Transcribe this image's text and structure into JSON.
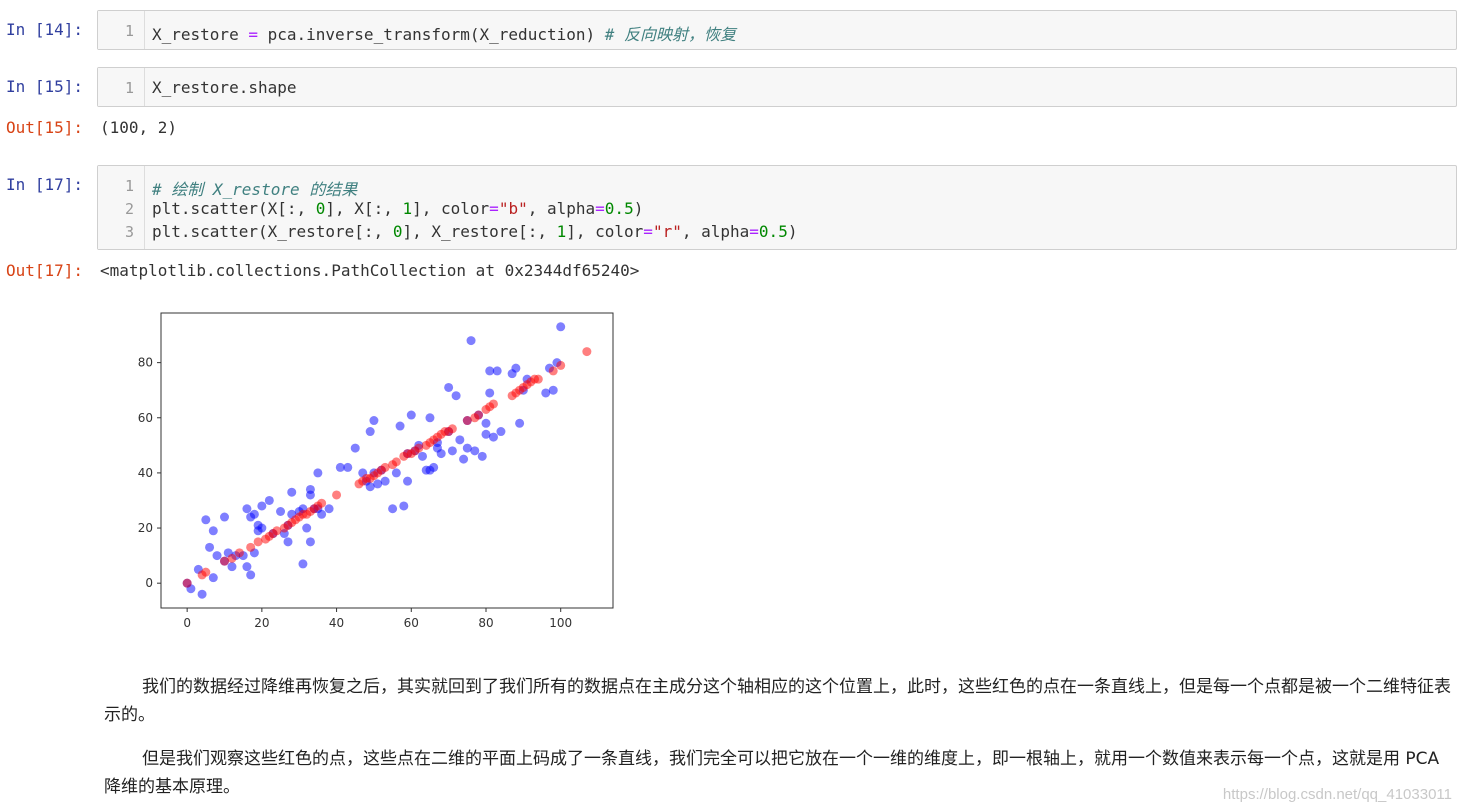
{
  "cells": [
    {
      "prompt": "In  [14]:",
      "lines": [
        {
          "n": "1",
          "parts": [
            {
              "t": "X_restore ",
              "c": ""
            },
            {
              "t": "=",
              "c": "op"
            },
            {
              "t": " pca.inverse_transform(X_reduction) ",
              "c": ""
            },
            {
              "t": "# 反向映射，恢复",
              "c": "cm"
            }
          ]
        }
      ]
    },
    {
      "prompt": "In  [15]:",
      "lines": [
        {
          "n": "1",
          "parts": [
            {
              "t": "X_restore.shape",
              "c": ""
            }
          ]
        }
      ],
      "out_prompt": "Out[15]:",
      "out": "(100, 2)"
    },
    {
      "prompt": "In  [17]:",
      "lines": [
        {
          "n": "1",
          "parts": [
            {
              "t": "# 绘制 X_restore 的结果",
              "c": "cm"
            }
          ]
        },
        {
          "n": "2",
          "parts": [
            {
              "t": "plt.scatter(X[:, ",
              "c": ""
            },
            {
              "t": "0",
              "c": "num"
            },
            {
              "t": "], X[:, ",
              "c": ""
            },
            {
              "t": "1",
              "c": "num"
            },
            {
              "t": "], color",
              "c": ""
            },
            {
              "t": "=",
              "c": "op"
            },
            {
              "t": "\"b\"",
              "c": "str"
            },
            {
              "t": ", alpha",
              "c": ""
            },
            {
              "t": "=",
              "c": "op"
            },
            {
              "t": "0.5",
              "c": "num"
            },
            {
              "t": ")",
              "c": ""
            }
          ]
        },
        {
          "n": "3",
          "parts": [
            {
              "t": "plt.scatter(X_restore[:, ",
              "c": ""
            },
            {
              "t": "0",
              "c": "num"
            },
            {
              "t": "], X_restore[:, ",
              "c": ""
            },
            {
              "t": "1",
              "c": "num"
            },
            {
              "t": "], color",
              "c": ""
            },
            {
              "t": "=",
              "c": "op"
            },
            {
              "t": "\"r\"",
              "c": "str"
            },
            {
              "t": ", alpha",
              "c": ""
            },
            {
              "t": "=",
              "c": "op"
            },
            {
              "t": "0.5",
              "c": "num"
            },
            {
              "t": ")",
              "c": ""
            }
          ]
        }
      ],
      "out_prompt": "Out[17]:",
      "out": "<matplotlib.collections.PathCollection at 0x2344df65240>"
    }
  ],
  "paragraphs": [
    "我们的数据经过降维再恢复之后，其实就回到了我们所有的数据点在主成分这个轴相应的这个位置上，此时，这些红色的点在一条直线上，但是每一个点都是被一个二维特征表示的。",
    "但是我们观察这些红色的点，这些点在二维的平面上码成了一条直线，我们完全可以把它放在一个一维的维度上，即一根轴上，就用一个数值来表示每一个点，这就是用 PCA 降维的基本原理。"
  ],
  "watermark": "https://blog.csdn.net/qq_41033011",
  "chart_data": {
    "type": "scatter",
    "xlim": [
      -7,
      114
    ],
    "ylim": [
      -9,
      98
    ],
    "xticks": [
      "0",
      "20",
      "40",
      "60",
      "80",
      "100"
    ],
    "yticks": [
      "0",
      "20",
      "40",
      "60",
      "80"
    ],
    "grid": false,
    "series": [
      {
        "color": "#0000ff",
        "alpha": 0.5,
        "points": [
          [
            0,
            0
          ],
          [
            1,
            -2
          ],
          [
            3,
            5
          ],
          [
            4,
            -4
          ],
          [
            5,
            23
          ],
          [
            6,
            13
          ],
          [
            7,
            2
          ],
          [
            7,
            19
          ],
          [
            8,
            10
          ],
          [
            10,
            8
          ],
          [
            10,
            24
          ],
          [
            11,
            11
          ],
          [
            12,
            6
          ],
          [
            13,
            10
          ],
          [
            15,
            10
          ],
          [
            16,
            6
          ],
          [
            16,
            27
          ],
          [
            17,
            3
          ],
          [
            17,
            24
          ],
          [
            18,
            25
          ],
          [
            18,
            11
          ],
          [
            19,
            21
          ],
          [
            19,
            19
          ],
          [
            20,
            20
          ],
          [
            20,
            28
          ],
          [
            22,
            30
          ],
          [
            23,
            18
          ],
          [
            25,
            26
          ],
          [
            26,
            18
          ],
          [
            27,
            15
          ],
          [
            27,
            21
          ],
          [
            28,
            25
          ],
          [
            28,
            33
          ],
          [
            30,
            26
          ],
          [
            31,
            27
          ],
          [
            31,
            7
          ],
          [
            32,
            20
          ],
          [
            33,
            32
          ],
          [
            33,
            34
          ],
          [
            33,
            15
          ],
          [
            34,
            27
          ],
          [
            35,
            27
          ],
          [
            35,
            40
          ],
          [
            36,
            25
          ],
          [
            38,
            27
          ],
          [
            41,
            42
          ],
          [
            43,
            42
          ],
          [
            45,
            49
          ],
          [
            47,
            40
          ],
          [
            48,
            37
          ],
          [
            49,
            35
          ],
          [
            49,
            55
          ],
          [
            50,
            40
          ],
          [
            50,
            59
          ],
          [
            51,
            36
          ],
          [
            52,
            41
          ],
          [
            53,
            37
          ],
          [
            55,
            27
          ],
          [
            56,
            40
          ],
          [
            57,
            57
          ],
          [
            58,
            28
          ],
          [
            59,
            47
          ],
          [
            59,
            37
          ],
          [
            60,
            61
          ],
          [
            61,
            48
          ],
          [
            62,
            50
          ],
          [
            63,
            46
          ],
          [
            64,
            41
          ],
          [
            65,
            41
          ],
          [
            65,
            60
          ],
          [
            66,
            42
          ],
          [
            67,
            51
          ],
          [
            67,
            49
          ],
          [
            68,
            47
          ],
          [
            70,
            71
          ],
          [
            70,
            55
          ],
          [
            71,
            48
          ],
          [
            72,
            68
          ],
          [
            73,
            52
          ],
          [
            74,
            45
          ],
          [
            75,
            49
          ],
          [
            75,
            59
          ],
          [
            76,
            88
          ],
          [
            77,
            48
          ],
          [
            78,
            61
          ],
          [
            79,
            46
          ],
          [
            80,
            54
          ],
          [
            80,
            58
          ],
          [
            81,
            69
          ],
          [
            81,
            77
          ],
          [
            82,
            53
          ],
          [
            83,
            77
          ],
          [
            84,
            55
          ],
          [
            87,
            76
          ],
          [
            88,
            78
          ],
          [
            89,
            58
          ],
          [
            90,
            70
          ],
          [
            91,
            74
          ],
          [
            96,
            69
          ],
          [
            97,
            78
          ],
          [
            98,
            70
          ],
          [
            99,
            80
          ],
          [
            100,
            93
          ]
        ]
      },
      {
        "color": "#ff0000",
        "alpha": 0.5,
        "points": [
          [
            0,
            0
          ],
          [
            4,
            3
          ],
          [
            5,
            4
          ],
          [
            10,
            8
          ],
          [
            12,
            9
          ],
          [
            14,
            11
          ],
          [
            17,
            13
          ],
          [
            19,
            15
          ],
          [
            21,
            16
          ],
          [
            22,
            17
          ],
          [
            23,
            18
          ],
          [
            24,
            19
          ],
          [
            26,
            20
          ],
          [
            27,
            21
          ],
          [
            28,
            22
          ],
          [
            29,
            23
          ],
          [
            30,
            24
          ],
          [
            31,
            25
          ],
          [
            32,
            25
          ],
          [
            33,
            26
          ],
          [
            34,
            27
          ],
          [
            35,
            28
          ],
          [
            36,
            29
          ],
          [
            40,
            32
          ],
          [
            46,
            36
          ],
          [
            47,
            37
          ],
          [
            48,
            38
          ],
          [
            49,
            38
          ],
          [
            50,
            39
          ],
          [
            51,
            40
          ],
          [
            52,
            41
          ],
          [
            53,
            42
          ],
          [
            55,
            43
          ],
          [
            56,
            44
          ],
          [
            58,
            46
          ],
          [
            59,
            47
          ],
          [
            60,
            47
          ],
          [
            61,
            48
          ],
          [
            62,
            49
          ],
          [
            64,
            50
          ],
          [
            65,
            51
          ],
          [
            66,
            52
          ],
          [
            67,
            53
          ],
          [
            68,
            54
          ],
          [
            69,
            55
          ],
          [
            70,
            55
          ],
          [
            71,
            56
          ],
          [
            75,
            59
          ],
          [
            77,
            60
          ],
          [
            78,
            61
          ],
          [
            80,
            63
          ],
          [
            81,
            64
          ],
          [
            82,
            65
          ],
          [
            87,
            68
          ],
          [
            88,
            69
          ],
          [
            89,
            70
          ],
          [
            90,
            71
          ],
          [
            91,
            72
          ],
          [
            92,
            73
          ],
          [
            93,
            74
          ],
          [
            94,
            74
          ],
          [
            98,
            77
          ],
          [
            100,
            79
          ],
          [
            107,
            84
          ]
        ]
      }
    ]
  }
}
